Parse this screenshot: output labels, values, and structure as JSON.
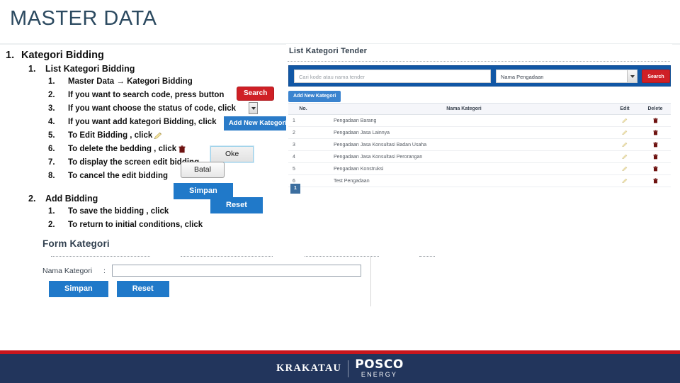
{
  "slide": {
    "title": "MASTER DATA"
  },
  "outline": {
    "section1": {
      "num": "1.",
      "label": "Kategori Bidding",
      "sub1": {
        "num": "1.",
        "label": "List Kategori Bidding",
        "steps": [
          {
            "num": "1.",
            "text": "Master Data → Kategori Bidding"
          },
          {
            "num": "2.",
            "text": "If you want to search code, press button"
          },
          {
            "num": "3.",
            "text": "If you want choose the status of code, click"
          },
          {
            "num": "4.",
            "text": "If you want add kategori Bidding, click"
          },
          {
            "num": "5.",
            "text": "To Edit Bidding , click"
          },
          {
            "num": "6.",
            "text": "To delete the bedding , click"
          },
          {
            "num": "7.",
            "text": "To display the screen edit bidding"
          },
          {
            "num": "8.",
            "text": "To cancel the edit bidding"
          }
        ]
      },
      "sub2": {
        "num": "2.",
        "label": "Add Bidding",
        "steps": [
          {
            "num": "1.",
            "text": "To save the bidding , click"
          },
          {
            "num": "2.",
            "text": "To return to initial conditions, click"
          }
        ]
      }
    },
    "callouts": {
      "search": "Search",
      "add_new_kategori": "Add New Kategori",
      "oke": "Oke",
      "batal": "Batal",
      "simpan": "Simpan",
      "reset": "Reset"
    },
    "icons": {
      "edit": "pencil-icon",
      "delete": "trash-icon",
      "dropdown": "caret-down-icon"
    }
  },
  "form_kategori": {
    "title": "Form Kategori",
    "field_label": "Nama Kategori",
    "colon": ":",
    "field_value": "",
    "field_placeholder": "",
    "save_label": "Simpan",
    "reset_label": "Reset"
  },
  "app": {
    "title": "List Kategori Tender",
    "search": {
      "placeholder": "Cari kode atau nama tender",
      "value": "",
      "select_value": "Nama Pengadaan",
      "button_label": "Search"
    },
    "add_button": "Add New Kategori",
    "table": {
      "headers": [
        "No.",
        "Nama Kategori",
        "Edit",
        "Delete"
      ],
      "rows": [
        {
          "no": "1",
          "nama": "Pengadaan Barang"
        },
        {
          "no": "2",
          "nama": "Pengadaan Jasa Lainnya"
        },
        {
          "no": "3",
          "nama": "Pengadaan Jasa Konsultasi Badan Usaha"
        },
        {
          "no": "4",
          "nama": "Pengadaan Jasa Konsultasi Perorangan"
        },
        {
          "no": "5",
          "nama": "Pengadaan Konstruksi"
        },
        {
          "no": "6",
          "nama": "Test Pengadaan"
        }
      ]
    },
    "pagination": {
      "current": "1"
    }
  },
  "footer": {
    "brand_left": "KRAKATAU",
    "brand_right": "POSCO",
    "brand_sub": "ENERGY"
  },
  "colors": {
    "title": "#2c4a60",
    "accent_red": "#cf2026",
    "accent_blue": "#2079c9",
    "search_bar_blue": "#1157a5",
    "footer_navy": "#22355c",
    "footer_red": "#c8161d"
  }
}
